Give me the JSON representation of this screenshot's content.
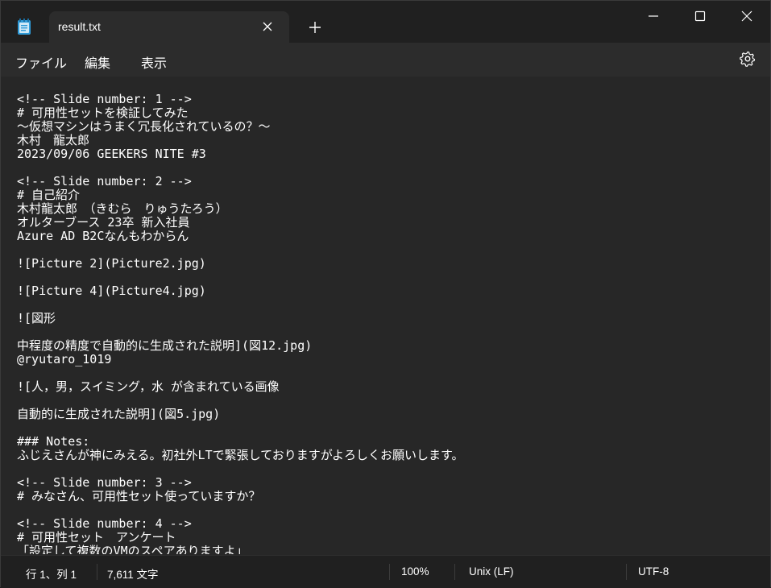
{
  "tab": {
    "filename": "result.txt"
  },
  "menu": {
    "file": "ファイル",
    "edit": "編集",
    "view": "表示"
  },
  "icons": {
    "app": "notepad-icon",
    "close_tab": "close-icon",
    "new_tab": "plus-icon",
    "minimize": "minimize-icon",
    "maximize": "maximize-icon",
    "close_window": "close-icon",
    "settings": "gear-icon"
  },
  "editor": {
    "content": "<!-- Slide number: 1 -->\n# 可用性セットを検証してみた\n～仮想マシンはうまく冗長化されているの？～\n木村　龍太郎\n2023/09/06 GEEKERS NITE #3\n\n<!-- Slide number: 2 -->\n# 自己紹介\n木村龍太郎　（きむら　りゅうたろう）\nオルターブース 23卒 新入社員\nAzure AD B2Cなんもわからん\n\n![Picture 2](Picture2.jpg)\n\n![Picture 4](Picture4.jpg)\n\n![図形\n\n中程度の精度で自動的に生成された説明](図12.jpg)\n@ryutaro_1019\n\n![人，男，スイミング，水 が含まれている画像\n\n自動的に生成された説明](図5.jpg)\n\n### Notes:\nふじえさんが神にみえる。初社外LTで緊張しておりますがよろしくお願いします。\n\n<!-- Slide number: 3 -->\n# みなさん、可用性セット使っていますか？\n\n<!-- Slide number: 4 -->\n# 可用性セット　アンケート\n「設定して複数のVMのスペアありますよ」"
  },
  "status": {
    "position": "行 1、列 1",
    "chars": "7,611 文字",
    "zoom": "100%",
    "line_ending": "Unix (LF)",
    "encoding": "UTF-8"
  },
  "colors": {
    "titlebar": "#202020",
    "tab": "#2c2c2c",
    "editor_bg": "#272727",
    "text": "#ffffff",
    "app_icon_accent": "#2f9bd8"
  }
}
